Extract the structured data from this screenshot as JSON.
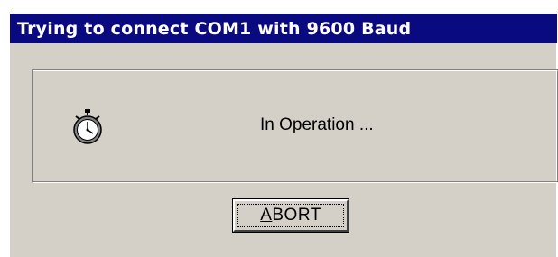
{
  "window": {
    "title": "Trying to connect COM1 with 9600 Baud"
  },
  "status": {
    "icon": "stopwatch-icon",
    "text": "In Operation ..."
  },
  "button": {
    "abort_mnemonic": "A",
    "abort_rest": "BORT"
  },
  "colors": {
    "titlebar": "#0a0a80",
    "face": "#d4d0c8"
  }
}
